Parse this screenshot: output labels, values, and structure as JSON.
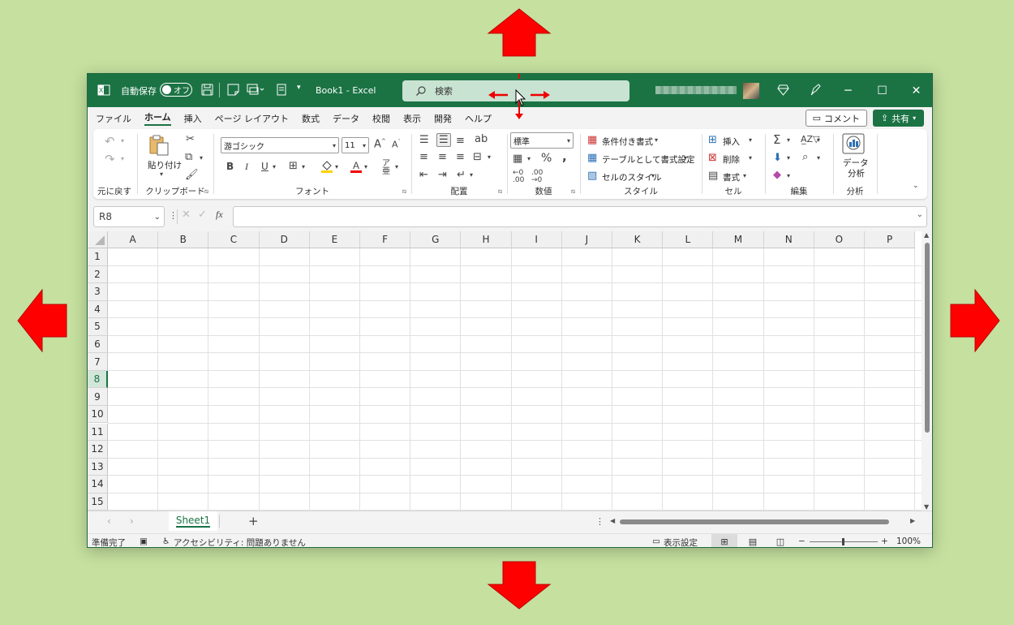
{
  "titlebar": {
    "autosave_label": "自動保存",
    "autosave_state": "オフ",
    "doc_title": "Book1  -  Excel",
    "search_placeholder": "検索"
  },
  "menu_tabs": [
    "ファイル",
    "ホーム",
    "挿入",
    "ページ レイアウト",
    "数式",
    "データ",
    "校閲",
    "表示",
    "開発",
    "ヘルプ"
  ],
  "active_tab": "ホーム",
  "comment_button": "コメント",
  "share_button": "共有",
  "ribbon": {
    "undo_group": "元に戻す",
    "clipboard": {
      "paste": "貼り付け",
      "label": "クリップボード"
    },
    "font": {
      "name": "游ゴシック",
      "size": "11",
      "label": "フォント"
    },
    "alignment": {
      "label": "配置"
    },
    "number": {
      "format": "標準",
      "label": "数値"
    },
    "styles": {
      "conditional": "条件付き書式",
      "table": "テーブルとして書式設定",
      "cell_styles": "セルのスタイル",
      "label": "スタイル"
    },
    "cells": {
      "insert": "挿入",
      "delete": "削除",
      "format": "書式",
      "label": "セル"
    },
    "editing": {
      "label": "編集"
    },
    "analysis": {
      "data_analysis_line1": "データ",
      "data_analysis_line2": "分析",
      "label": "分析"
    }
  },
  "formula_bar": {
    "name_box": "R8",
    "fx": "fx",
    "formula": ""
  },
  "columns": [
    "A",
    "B",
    "C",
    "D",
    "E",
    "F",
    "G",
    "H",
    "I",
    "J",
    "K",
    "L",
    "M",
    "N",
    "O",
    "P"
  ],
  "rows": [
    "1",
    "2",
    "3",
    "4",
    "5",
    "6",
    "7",
    "8",
    "9",
    "10",
    "11",
    "12",
    "13",
    "14",
    "15"
  ],
  "selected_row": "8",
  "sheet_tab": "Sheet1",
  "status": {
    "ready": "準備完了",
    "accessibility": "アクセシビリティ: 問題ありません",
    "display_settings": "表示設定",
    "zoom": "100%"
  },
  "colors": {
    "excel_green": "#1b7344",
    "background": "#c5e09f",
    "arrow_red": "#ff0000"
  }
}
